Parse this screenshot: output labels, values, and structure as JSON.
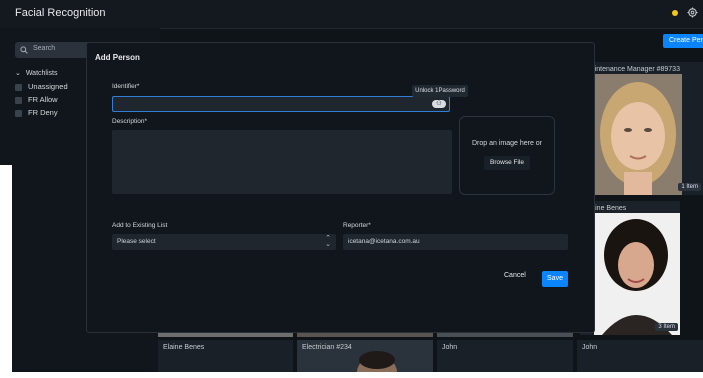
{
  "app": {
    "title": "Facial Recognition"
  },
  "header": {
    "create_button": "Create Person"
  },
  "sidebar": {
    "search_placeholder": "Search",
    "watchlists_label": "Watchlists",
    "items": [
      {
        "label": "Unassigned"
      },
      {
        "label": "FR Allow"
      },
      {
        "label": "FR Deny"
      }
    ]
  },
  "cards": [
    {
      "caption": "Maintenance Manager #89733",
      "badge": "1 Item"
    },
    {
      "caption": "Elaine Benes",
      "badge": "3 Item"
    }
  ],
  "bottom_row": [
    "Elaine Benes",
    "Electrician #234",
    "John",
    "John"
  ],
  "modal": {
    "title": "Add Person",
    "identifier_label": "Identifier*",
    "identifier_value": "",
    "tooltip": "Unlock 1Password",
    "description_label": "Description*",
    "description_value": "",
    "drop_text": "Drop an image here or",
    "browse_button": "Browse File",
    "list_label": "Add to Existing List",
    "list_value": "Please select",
    "reporter_label": "Reporter*",
    "reporter_value": "icetana@icetana.com.au",
    "cancel": "Cancel",
    "save": "Save"
  },
  "colors": {
    "accent": "#0a84ff",
    "status_dot": "#f5c518",
    "background": "#0f1419"
  }
}
